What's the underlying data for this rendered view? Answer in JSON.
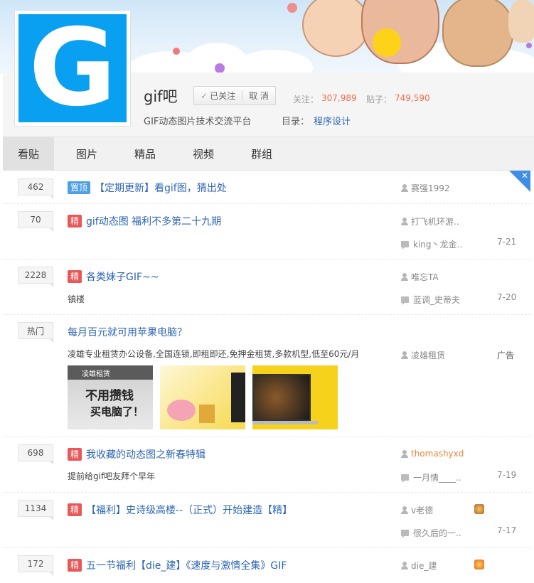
{
  "forum": {
    "name": "gif吧",
    "logo_letter": "G",
    "slogan": "GIF动态图片技术交流平台",
    "follow_label": "已关注",
    "unfollow_label": "取 消",
    "followers_label": "关注：",
    "followers_value": "307,989",
    "posts_label": "贴子：",
    "posts_value": "749,590",
    "directory_label": "目录：",
    "directory_value": "程序设计"
  },
  "tabs": [
    "看贴",
    "图片",
    "精品",
    "视频",
    "群组"
  ],
  "threads": [
    {
      "count": "462",
      "badge": "置顶",
      "title": "【定期更新】看gif图，猜出处",
      "author": "赛强1992"
    },
    {
      "count": "70",
      "badge": "精",
      "title": "gif动态图 福利不多第二十九期",
      "author": "打飞机环游..",
      "reply": "king丶龙金..",
      "time": "7-21"
    },
    {
      "count": "2228",
      "badge": "精",
      "title": "各类妹子GIF~~",
      "excerpt": "镇楼",
      "author": "唯忘TA",
      "reply": "蓝调_史蒂夫",
      "time": "7-20"
    },
    {
      "count": "热门",
      "title": "每月百元就可用苹果电脑？",
      "excerpt": "凌雄专业租赁办公设备,全国连锁,即租即还,免押金租赁,多款机型,低至60元/月",
      "author": "凌雄租赁",
      "ad": "广告",
      "ad_img1_line1": "不用攒钱",
      "ad_img1_line2": "买电脑了！",
      "ad_img1_brand": "凌雄租赁"
    },
    {
      "count": "698",
      "badge": "精",
      "title": "我收藏的动态图之新春特辑",
      "excerpt": "提前给gif吧友拜个早年",
      "author": "thomashyxd",
      "reply": "一月情____..",
      "time": "7-19"
    },
    {
      "count": "1134",
      "badge": "精",
      "title": "【福利】史诗级高楼--（正式）开始建造【精】",
      "author": "v老德",
      "reply": "很久后的一..",
      "time": "7-17"
    },
    {
      "count": "172",
      "badge": "精",
      "title": "五一节福利【die_建】《速度与激情全集》GIF",
      "author": "die_建"
    }
  ],
  "colors": {
    "link": "#2d64b3",
    "badge_top": "#4f9ee6",
    "badge_jing": "#e85858",
    "stat": "#f26c4f",
    "logo_bg": "#0aa0f2"
  }
}
